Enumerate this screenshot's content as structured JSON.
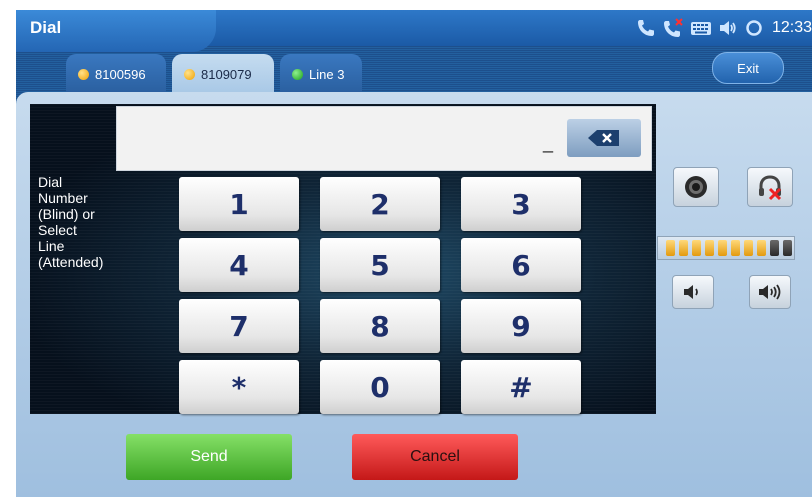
{
  "header": {
    "title": "Dial",
    "time": "12:33",
    "icons": [
      "phone-icon",
      "missed-call-icon",
      "keyboard-icon",
      "speaker-icon",
      "refresh-icon"
    ]
  },
  "tabs": [
    {
      "label": "8100596",
      "status": "orange"
    },
    {
      "label": "8109079",
      "status": "orange",
      "active": true
    },
    {
      "label": "Line 3",
      "status": "green"
    }
  ],
  "exit_label": "Exit",
  "dial": {
    "label": "Dial\nNumber\n(Blind) or\nSelect\nLine\n(Attended)",
    "input_value": "_"
  },
  "keypad": [
    "1",
    "2",
    "3",
    "4",
    "5",
    "6",
    "7",
    "8",
    "9",
    "*",
    "0",
    "#"
  ],
  "volume": {
    "level": 8,
    "max": 10
  },
  "actions": {
    "send": "Send",
    "cancel": "Cancel"
  },
  "colors": {
    "send": "#3ea626",
    "cancel": "#c41818",
    "accent": "#1d4f8c"
  }
}
